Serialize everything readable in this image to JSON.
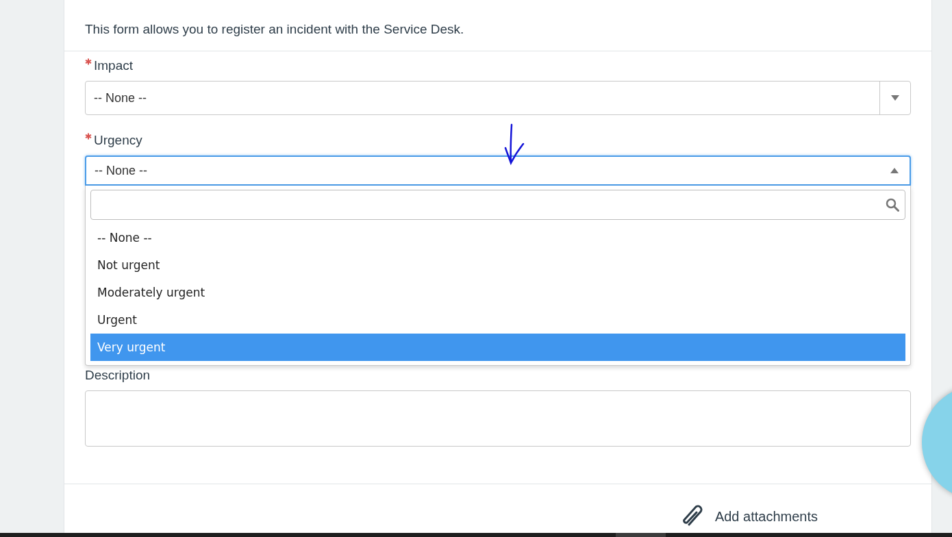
{
  "intro": "This form allows you to register an incident with the Service Desk.",
  "fields": [
    {
      "kind": "select",
      "label": "Impact",
      "required": true,
      "value": "-- None --",
      "expanded": false
    },
    {
      "kind": "select",
      "label": "Urgency",
      "required": true,
      "value": "-- None --",
      "expanded": true,
      "options": [
        {
          "label": "-- None --",
          "highlighted": false
        },
        {
          "label": "Not urgent",
          "highlighted": false
        },
        {
          "label": "Moderately urgent",
          "highlighted": false
        },
        {
          "label": "Urgent",
          "highlighted": false
        },
        {
          "label": "Very urgent",
          "highlighted": true
        }
      ]
    },
    {
      "kind": "textarea",
      "label": "Description",
      "required": false
    }
  ],
  "attachments": {
    "label": "Add attachments"
  }
}
